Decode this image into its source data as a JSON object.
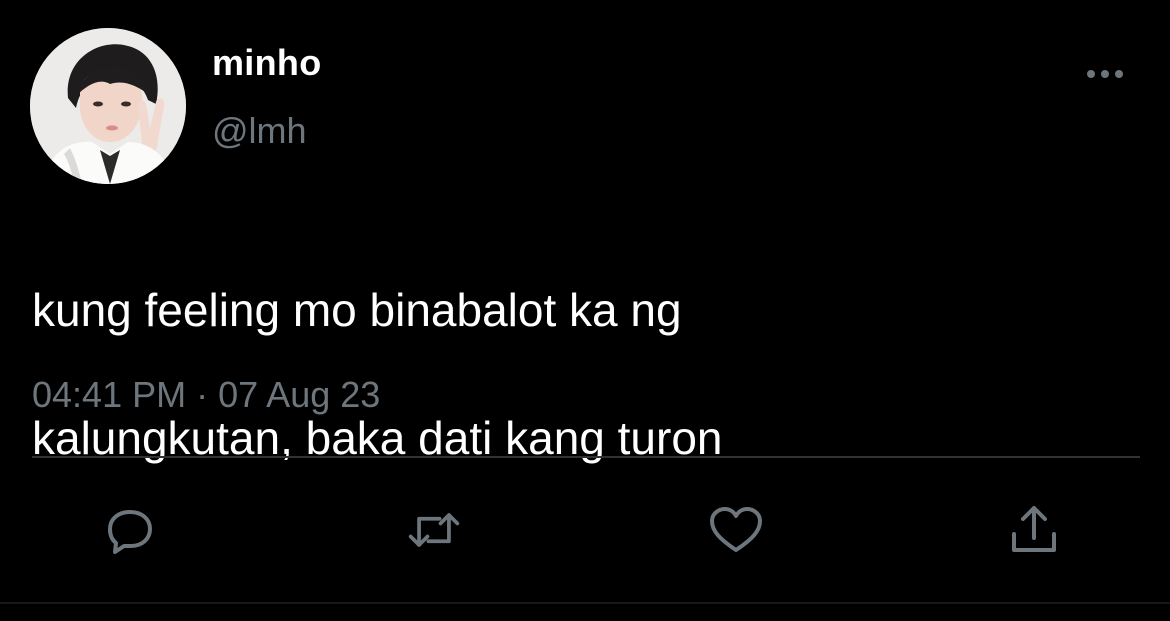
{
  "author": {
    "display_name": "minho",
    "handle": "@lmh"
  },
  "tweet": {
    "text_line1": "kung feeling mo binabalot ka ng",
    "text_line2": "kalungkutan, baka dati kang turon",
    "time": "04:41 PM",
    "separator": "·",
    "date": "07 Aug 23"
  },
  "icons": {
    "more": "more-horizontal-icon",
    "reply": "reply-icon",
    "retweet": "retweet-icon",
    "like": "heart-icon",
    "share": "share-icon"
  },
  "colors": {
    "background": "#000000",
    "primary_text": "#ffffff",
    "secondary_text": "#6e767d",
    "icon": "#6e767d",
    "divider": "#2f3336"
  }
}
